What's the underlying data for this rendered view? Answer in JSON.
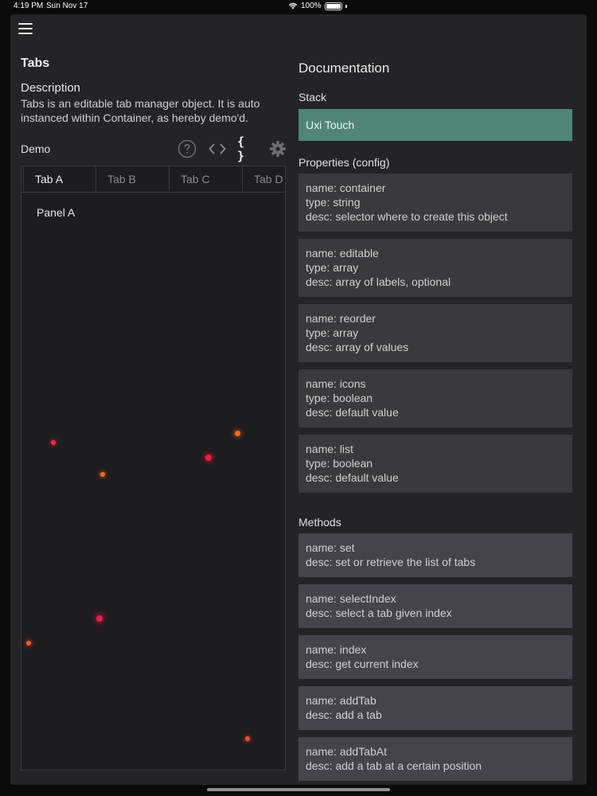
{
  "status": {
    "time": "4:19 PM",
    "date": "Sun Nov 17",
    "battery": "100%"
  },
  "left": {
    "title": "Tabs",
    "description_heading": "Description",
    "description_text": "Tabs is an editable tab manager object. It is auto instanced within Container, as hereby demo'd.",
    "demo_label": "Demo",
    "icons": [
      "help-circle-icon",
      "code-icon",
      "braces-icon",
      "gear-icon"
    ],
    "tabs": [
      "Tab A",
      "Tab B",
      "Tab C",
      "Tab D"
    ],
    "panel_label": "Panel A"
  },
  "right": {
    "doc_title": "Documentation",
    "stack_heading": "Stack",
    "stack_value": "Uxi Touch",
    "properties_heading": "Properties (config)",
    "properties": [
      {
        "name": "name: container",
        "type": "type: string",
        "desc": "desc: selector where to create this object"
      },
      {
        "name": "name: editable",
        "type": "type: array",
        "desc": "desc: array of labels, optional"
      },
      {
        "name": "name: reorder",
        "type": "type: array",
        "desc": "desc: array of values"
      },
      {
        "name": "name: icons",
        "type": "type: boolean",
        "desc": "desc: default value"
      },
      {
        "name": "name: list",
        "type": "type: boolean",
        "desc": "desc: default value"
      }
    ],
    "methods_heading": "Methods",
    "methods": [
      {
        "name": "name: set",
        "desc": "desc: set or retrieve the list of tabs"
      },
      {
        "name": "name: selectIndex",
        "desc": "desc: select a tab given index"
      },
      {
        "name": "name: index",
        "desc": "desc: get current index"
      },
      {
        "name": "name: addTab",
        "desc": "desc: add a tab"
      },
      {
        "name": "name: addTabAt",
        "desc": "desc: add a tab at a certain position"
      }
    ]
  },
  "colors": {
    "stack_accent": "#4f8677",
    "property_card": "#3a3a3c",
    "method_card": "#45444d",
    "particle_red": "#ff2a4a",
    "particle_orange": "#ff6a1a"
  }
}
